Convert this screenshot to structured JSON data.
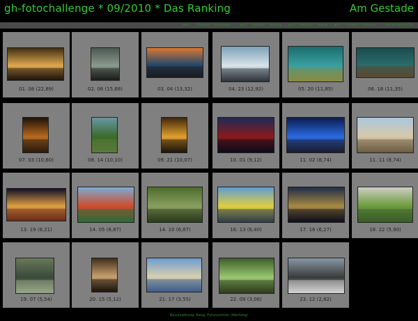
{
  "header": {
    "title": "gh-fotochallenge * 09/2010 * Das Ranking",
    "right_title": "Am Gestade"
  },
  "nav": {
    "links": [
      "Seit 1",
      "* 09/2010 * Hexentanz",
      "|",
      "* ghFC * 06/2010 * Ranking",
      "|",
      "ghFC * 09/2010 * Voting",
      "|",
      "ghFC * 10/2010 * Ranking *",
      "|",
      "Hall of Fame 2010"
    ]
  },
  "tiles": [
    {
      "caption": "01. 08 (22,89)",
      "icon": "sunset-rocks-photo",
      "colors": [
        "#3a2a12",
        "#e0a850",
        "#1a1208"
      ]
    },
    {
      "caption": "02. 06 (15,68)",
      "icon": "boat-shore-photo",
      "colors": [
        "#4a5550",
        "#8a9a90",
        "#1a1a18"
      ]
    },
    {
      "caption": "03. 04 (13,32)",
      "icon": "beach-sunset-photo",
      "colors": [
        "#e07a30",
        "#2a4a6a",
        "#1a1a20"
      ]
    },
    {
      "caption": "04. 23 (12,92)",
      "icon": "ice-beach-photo",
      "colors": [
        "#7aa0b8",
        "#d8e4ea",
        "#2a3038"
      ]
    },
    {
      "caption": "05. 20 (11,85)",
      "icon": "underwater-grass-photo",
      "colors": [
        "#1a6a6a",
        "#3aa0a0",
        "#8a8a40"
      ]
    },
    {
      "caption": "06. 18 (11,35)",
      "icon": "lake-stones-photo",
      "colors": [
        "#1a4a4a",
        "#2a6a6a",
        "#5a4a30"
      ]
    },
    {
      "caption": "07. 03 (10,60)",
      "icon": "dark-orange-photo",
      "colors": [
        "#1a0e08",
        "#b86a20",
        "#2a1a0e"
      ]
    },
    {
      "caption": "08. 14 (10,10)",
      "icon": "forest-river-photo",
      "colors": [
        "#6a9aa8",
        "#3a6a2a",
        "#5a7a3a"
      ]
    },
    {
      "caption": "09. 21 (10,07)",
      "icon": "golden-sunset-photo",
      "colors": [
        "#3a2208",
        "#e0a030",
        "#1a1208"
      ]
    },
    {
      "caption": "10. 01 (9,12)",
      "icon": "red-boat-reflection-photo",
      "colors": [
        "#1a2a5a",
        "#8a1a1a",
        "#0a0a1a"
      ]
    },
    {
      "caption": "11. 02 (8,74)",
      "icon": "blue-light-bridge-photo",
      "colors": [
        "#0a1a4a",
        "#2a6ae0",
        "#1a1a2a"
      ]
    },
    {
      "caption": "11. 11 (8,74)",
      "icon": "sandy-beach-photo",
      "colors": [
        "#a8c8e0",
        "#d8c8a8",
        "#6a5a40"
      ]
    },
    {
      "caption": "13. 19 (8,21)",
      "icon": "night-carousel-photo",
      "colors": [
        "#0a0a2a",
        "#e0a040",
        "#6a2a1a"
      ]
    },
    {
      "caption": "14. 05 (6,87)",
      "icon": "container-ship-photo",
      "colors": [
        "#7ab0d8",
        "#d04a2a",
        "#2a6a3a"
      ]
    },
    {
      "caption": "14. 10 (6,87)",
      "icon": "river-boat-trees-photo",
      "colors": [
        "#4a6a2a",
        "#8aa060",
        "#2a3a1a"
      ]
    },
    {
      "caption": "16. 13 (6,40)",
      "icon": "ferry-harbor-photo",
      "colors": [
        "#5a9ad8",
        "#e0d040",
        "#2a3a4a"
      ]
    },
    {
      "caption": "17. 16 (6,27)",
      "icon": "night-figure-photo",
      "colors": [
        "#1a2a4a",
        "#a88a40",
        "#0a0a1a"
      ]
    },
    {
      "caption": "18. 22 (5,90)",
      "icon": "green-shore-photo",
      "colors": [
        "#d0d0c8",
        "#6a9a3a",
        "#3a5a2a"
      ]
    },
    {
      "caption": "19. 07 (5,54)",
      "icon": "reeds-water-photo",
      "colors": [
        "#6a7a5a",
        "#3a4a3a",
        "#9aa88a"
      ]
    },
    {
      "caption": "20. 15 (5,12)",
      "icon": "sepia-pond-photo",
      "colors": [
        "#3a2a1a",
        "#c8a070",
        "#1a1208"
      ]
    },
    {
      "caption": "21. 17 (3,55)",
      "icon": "grass-lake-photo",
      "colors": [
        "#6a9ad0",
        "#d8d0b0",
        "#3a5a8a"
      ]
    },
    {
      "caption": "22. 09 (3,06)",
      "icon": "water-lilies-photo",
      "colors": [
        "#3a5a2a",
        "#9ac870",
        "#2a3a1a"
      ]
    },
    {
      "caption": "23. 12 (2,82)",
      "icon": "fishing-gear-photo",
      "colors": [
        "#8a9aa8",
        "#3a3a3a",
        "#d8d8d8"
      ]
    }
  ],
  "footer": {
    "text": "Beschreibung: Rang. Fotonummer (Wertung)"
  }
}
